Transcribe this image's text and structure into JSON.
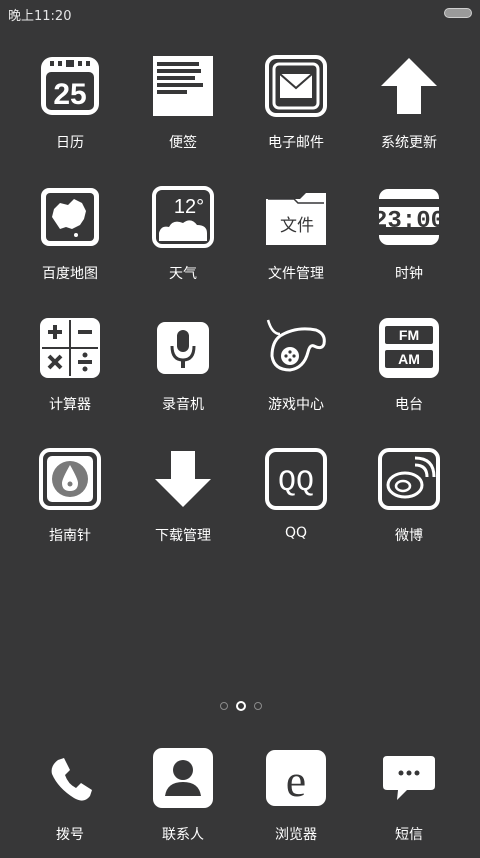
{
  "status": {
    "time": "晚上11:20"
  },
  "apps": [
    {
      "label": "日历",
      "icon": "calendar-icon",
      "date": "25"
    },
    {
      "label": "便签",
      "icon": "notes-icon"
    },
    {
      "label": "电子邮件",
      "icon": "email-icon"
    },
    {
      "label": "系统更新",
      "icon": "update-arrow-icon"
    },
    {
      "label": "百度地图",
      "icon": "map-icon"
    },
    {
      "label": "天气",
      "icon": "weather-icon",
      "temp": "12°"
    },
    {
      "label": "文件管理",
      "icon": "folder-icon",
      "folder_text": "文件"
    },
    {
      "label": "时钟",
      "icon": "clock-icon",
      "time": "23:00"
    },
    {
      "label": "计算器",
      "icon": "calculator-icon"
    },
    {
      "label": "录音机",
      "icon": "microphone-icon"
    },
    {
      "label": "游戏中心",
      "icon": "gamepad-icon"
    },
    {
      "label": "电台",
      "icon": "radio-icon",
      "fm": "FM",
      "am": "AM"
    },
    {
      "label": "指南针",
      "icon": "compass-icon"
    },
    {
      "label": "下载管理",
      "icon": "download-arrow-icon"
    },
    {
      "label": "QQ",
      "icon": "qq-icon",
      "text": "QQ"
    },
    {
      "label": "微博",
      "icon": "weibo-icon"
    }
  ],
  "page_indicator": {
    "pages": 3,
    "active": 1
  },
  "dock": [
    {
      "label": "拨号",
      "icon": "phone-icon"
    },
    {
      "label": "联系人",
      "icon": "contacts-icon"
    },
    {
      "label": "浏览器",
      "icon": "browser-icon",
      "letter": "e"
    },
    {
      "label": "短信",
      "icon": "message-icon"
    }
  ],
  "colors": {
    "background": "#373738",
    "icon": "#ffffff",
    "text": "#ffffff"
  }
}
